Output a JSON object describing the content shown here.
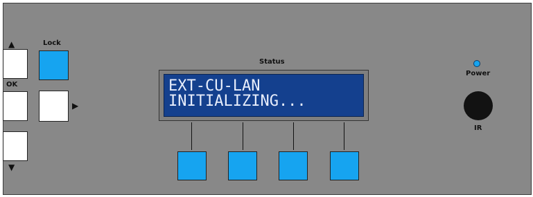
{
  "labels": {
    "lock": "Lock",
    "ok": "OK",
    "status": "Status",
    "power": "Power",
    "ir": "IR"
  },
  "lcd": {
    "line1": "EXT-CU-LAN",
    "line2": "INITIALIZING..."
  },
  "glyphs": {
    "up": "▲",
    "down": "▼",
    "right": "▶"
  },
  "colors": {
    "panel": "#888888",
    "accent_button": "#16a4f0",
    "lcd_background": "#14408e",
    "lcd_text": "#e8eefc",
    "power_led": "#16a4f0"
  },
  "icons": {
    "up_arrow": "up-arrow-icon",
    "down_arrow": "down-arrow-icon",
    "right_arrow": "right-arrow-icon"
  }
}
